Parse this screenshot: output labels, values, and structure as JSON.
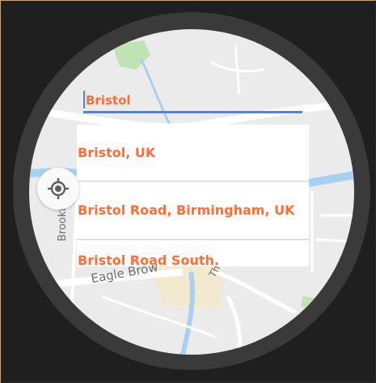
{
  "search": {
    "query": "Bristol"
  },
  "results": [
    {
      "label": "Bristol, UK"
    },
    {
      "label": "Bristol Road, Birmingham, UK"
    },
    {
      "label": "Bristol Road South."
    }
  ],
  "map": {
    "labels": {
      "road1": "Eagle Brow",
      "road2": "Brookfie",
      "road3": "Th"
    }
  },
  "icons": {
    "location": "my-location-icon"
  },
  "colors": {
    "accent": "#ff6d36",
    "search_line": "#4a84e8",
    "water": "#a8d0f0",
    "park": "#bfe3b4"
  }
}
